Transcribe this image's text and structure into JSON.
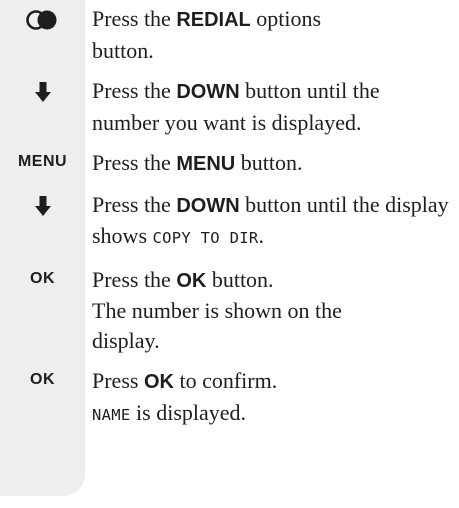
{
  "steps": [
    {
      "key_icon": "redial-options-icon",
      "pre": "Press the ",
      "bold": "REDIAL",
      "post": " options button."
    },
    {
      "key_icon": "down-arrow-icon",
      "pre": "Press the ",
      "bold": "DOWN",
      "post": " button until the number you want is displayed."
    },
    {
      "key_label": "MENU",
      "pre": "Press the ",
      "bold": "MENU",
      "post": " button."
    },
    {
      "key_icon": "down-arrow-icon",
      "pre": "Press the ",
      "bold": "DOWN",
      "post": " button until the display shows ",
      "lcd": "COPY TO DIR",
      "post2": "."
    },
    {
      "key_label": "OK",
      "pre": "Press the ",
      "bold": "OK",
      "post": " button.",
      "line2": "The number is shown on the display."
    },
    {
      "key_label": "OK",
      "pre": "Press ",
      "bold": "OK",
      "post": " to confirm.",
      "lcd": "NAME",
      "post2": " is displayed."
    }
  ]
}
